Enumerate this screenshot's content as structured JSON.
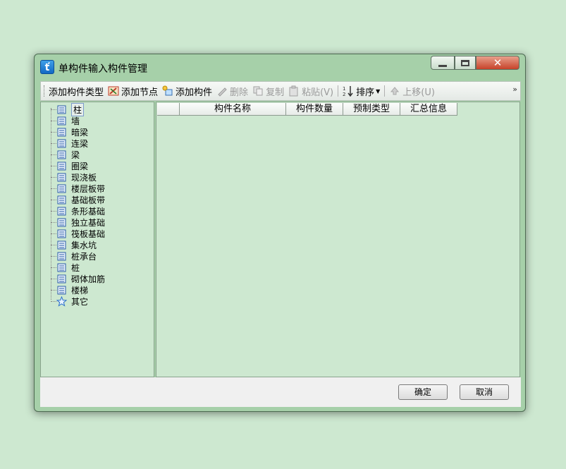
{
  "window": {
    "title": "单构件输入构件管理"
  },
  "toolbar": {
    "add_type": "添加构件类型",
    "add_node": "添加节点",
    "add_component": "添加构件",
    "delete": "删除",
    "copy": "复制",
    "paste": "粘贴(V)",
    "sort": "排序",
    "move_up": "上移(U)",
    "more": "»"
  },
  "tree": {
    "items": [
      {
        "label": "柱",
        "icon": "column-icon"
      },
      {
        "label": "墙",
        "icon": "wall-icon"
      },
      {
        "label": "暗梁",
        "icon": "hidden-beam-icon"
      },
      {
        "label": "连梁",
        "icon": "coupling-beam-icon"
      },
      {
        "label": "梁",
        "icon": "beam-icon"
      },
      {
        "label": "圈梁",
        "icon": "ring-beam-icon"
      },
      {
        "label": "现浇板",
        "icon": "cast-slab-icon"
      },
      {
        "label": "楼层板带",
        "icon": "floor-strip-icon"
      },
      {
        "label": "基础板带",
        "icon": "foundation-strip-icon"
      },
      {
        "label": "条形基础",
        "icon": "strip-foundation-icon"
      },
      {
        "label": "独立基础",
        "icon": "isolated-foundation-icon"
      },
      {
        "label": "筏板基础",
        "icon": "raft-foundation-icon"
      },
      {
        "label": "集水坑",
        "icon": "sump-pit-icon"
      },
      {
        "label": "桩承台",
        "icon": "pile-cap-icon"
      },
      {
        "label": "桩",
        "icon": "pile-icon"
      },
      {
        "label": "砌体加筋",
        "icon": "masonry-rebar-icon"
      },
      {
        "label": "楼梯",
        "icon": "stairs-icon"
      },
      {
        "label": "其它",
        "icon": "star-icon"
      }
    ]
  },
  "grid": {
    "columns": [
      "构件名称",
      "构件数量",
      "预制类型",
      "汇总信息"
    ]
  },
  "buttons": {
    "ok": "确定",
    "cancel": "取消"
  },
  "colors": {
    "window_bg": "#a6d0a9",
    "panel_bg": "#cde8d0",
    "close_red": "#c7432a"
  }
}
